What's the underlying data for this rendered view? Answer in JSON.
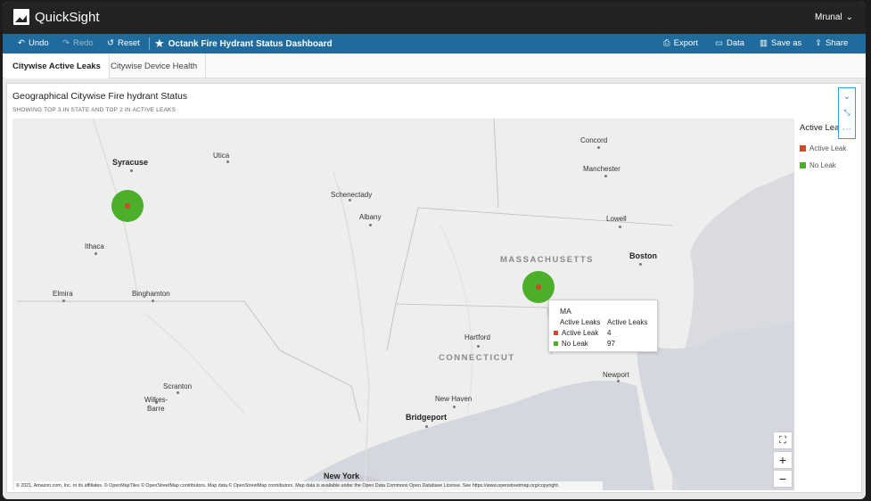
{
  "app": {
    "name": "QuickSight",
    "user": "Mrunal"
  },
  "toolbar": {
    "undo": "Undo",
    "redo": "Redo",
    "reset": "Reset",
    "dashboard_title": "Octank Fire Hydrant Status Dashboard",
    "export": "Export",
    "data": "Data",
    "save_as": "Save as",
    "share": "Share"
  },
  "tabs": [
    "Citywise Active Leaks",
    "Citywise Device Health"
  ],
  "visual": {
    "title": "Geographical Citywise Fire hydrant Status",
    "subtitle": "SHOWING TOP 3 IN STATE AND TOP 2 IN ACTIVE LEAKS"
  },
  "map": {
    "places": {
      "syracuse": "Syracuse",
      "utica": "Utica",
      "ithaca": "Ithaca",
      "elmira": "Elmira",
      "binghamton": "Binghamton",
      "scranton": "Scranton",
      "wilkes_barre_1": "Wilkes-",
      "wilkes_barre_2": "Barre",
      "schenectady": "Schenectady",
      "albany": "Albany",
      "concord": "Concord",
      "manchester": "Manchester",
      "lowell": "Lowell",
      "boston": "Boston",
      "massachusetts": "MASSACHUSETTS",
      "connecticut": "CONNECTICUT",
      "hartford": "Hartford",
      "new_haven": "New Haven",
      "bridgeport": "Bridgeport",
      "newport": "Newport",
      "new_york": "New York"
    },
    "attribution": "© 2021, Amazon.com, Inc. or its affiliates. © OpenMapTiles © OpenStreetMap contributors. Map data © OpenStreetMap contributors. Map data is available under the Open Data Commons Open Database License. See https://www.openstreetmap.org/copyright.",
    "zoom_in": "+",
    "zoom_out": "−"
  },
  "tooltip": {
    "state": "MA",
    "col_header_1": "Active Leaks",
    "col_header_2": "Active Leaks",
    "row1_label": "Active Leak",
    "row1_value": "4",
    "row2_label": "No Leak",
    "row2_value": "97"
  },
  "legend": {
    "title": "Active Leaks",
    "items": [
      {
        "label": "Active Leak",
        "color": "#d6452c"
      },
      {
        "label": "No Leak",
        "color": "#4caf2a"
      }
    ]
  },
  "colors": {
    "toolbar": "#1f6b9d",
    "topbar": "#232323",
    "active_leak": "#d6452c",
    "no_leak": "#4caf2a"
  }
}
